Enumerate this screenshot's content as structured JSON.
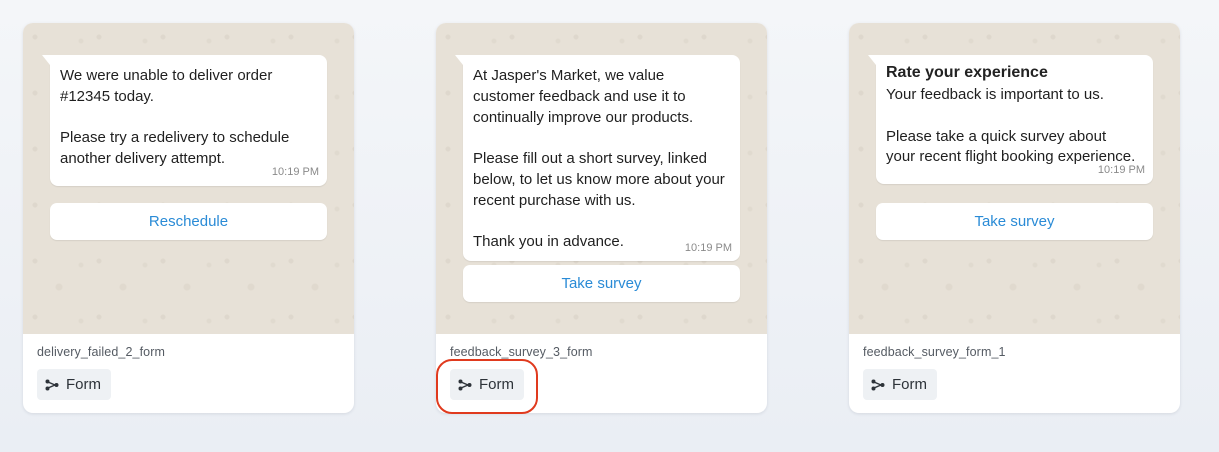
{
  "cards": [
    {
      "title": "",
      "body": "We were unable to deliver order #12345 today.\n\nPlease try a redelivery to schedule another delivery attempt.",
      "time": "10:19 PM",
      "button_label": "Reschedule",
      "template_name": "delivery_failed_2_form",
      "type_label": "Form",
      "type_icon": "flow-icon"
    },
    {
      "title": "",
      "body": "At Jasper's Market, we value customer feedback and use it to continually improve our products.\n\nPlease fill out a short survey, linked below, to let us know more about your recent purchase with us.\n\nThank you in advance.",
      "time": "10:19 PM",
      "button_label": "Take survey",
      "template_name": "feedback_survey_3_form",
      "type_label": "Form",
      "type_icon": "flow-icon"
    },
    {
      "title": "Rate your experience",
      "body": "Your feedback is important to us.\n\nPlease take a quick survey about your recent flight booking experience.",
      "time": "10:19 PM",
      "button_label": "Take survey",
      "template_name": "feedback_survey_form_1",
      "type_label": "Form",
      "type_icon": "flow-icon"
    }
  ],
  "colors": {
    "chat_background": "#e7e1d7",
    "button_text": "#2a8bd6",
    "highlight": "#e03a1e",
    "chip_background": "#eef1f4"
  }
}
